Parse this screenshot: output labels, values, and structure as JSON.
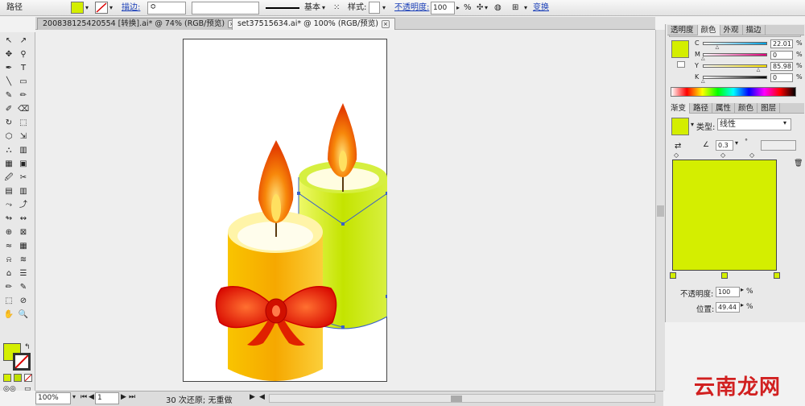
{
  "control_bar": {
    "object_label": "路径",
    "fill_color": "#d4ee00",
    "stroke_label": "描边:",
    "stroke_spinner": "≎",
    "brush_label": "基本",
    "style_label": "样式:",
    "opacity_label": "不透明度:",
    "opacity_value": "100",
    "percent": "%",
    "transform_label": "变换"
  },
  "tabs": [
    {
      "label": "200838125420554 [转换].ai* @ 74% (RGB/预览)",
      "close": "×"
    },
    {
      "label": "set37515634.ai* @ 100% (RGB/预览)",
      "close": "×"
    }
  ],
  "tools": {
    "fill_color": "#d4ee00",
    "glyphs": [
      "↖",
      "↗",
      "✥",
      "⚲",
      "✒",
      "T",
      "╲",
      "▭",
      "✎",
      "✏",
      "✐",
      "⌫",
      "↻",
      "⬚",
      "⬡",
      "⇲",
      "⛬",
      "▥",
      "▦",
      "▣",
      "🖉",
      "✂",
      "▤",
      "▥",
      "⤳",
      "⤴",
      "↬",
      "↭",
      "⊕",
      "⊠",
      "≈",
      "▦",
      "⍾",
      "≋",
      "⌂",
      "☰",
      "✏",
      "✎",
      "⬚",
      "⊘",
      "✋",
      "🔍"
    ]
  },
  "candles": {
    "orange_color": "#f7a600",
    "green_color": "#c8e600",
    "flame_color": "#ef5a00",
    "ribbon_color": "#e41a08"
  },
  "panel": {
    "color_tabs": [
      "透明度",
      "颜色",
      "外观",
      "描边"
    ],
    "cmyk": [
      {
        "label": "C",
        "value": "22.01",
        "level": 22.01
      },
      {
        "label": "M",
        "value": "0",
        "level": 0
      },
      {
        "label": "Y",
        "value": "85.98",
        "level": 85.98
      },
      {
        "label": "K",
        "value": "0",
        "level": 0
      }
    ],
    "gradient_tabs": [
      "渐变",
      "路径",
      "属性",
      "颜色",
      "图层"
    ],
    "type_label": "类型:",
    "type_value": "线性",
    "angle_value": "0.3",
    "degree": "°",
    "gradient_color": "#d4ee00",
    "opacity_label": "不透明度:",
    "opacity_value": "100",
    "position_label": "位置:",
    "position_value": "49.44",
    "percent": "%"
  },
  "status": {
    "zoom": "100%",
    "page": "1",
    "undo_text": "30 次还原; 无重做"
  },
  "watermark": "云南龙网"
}
